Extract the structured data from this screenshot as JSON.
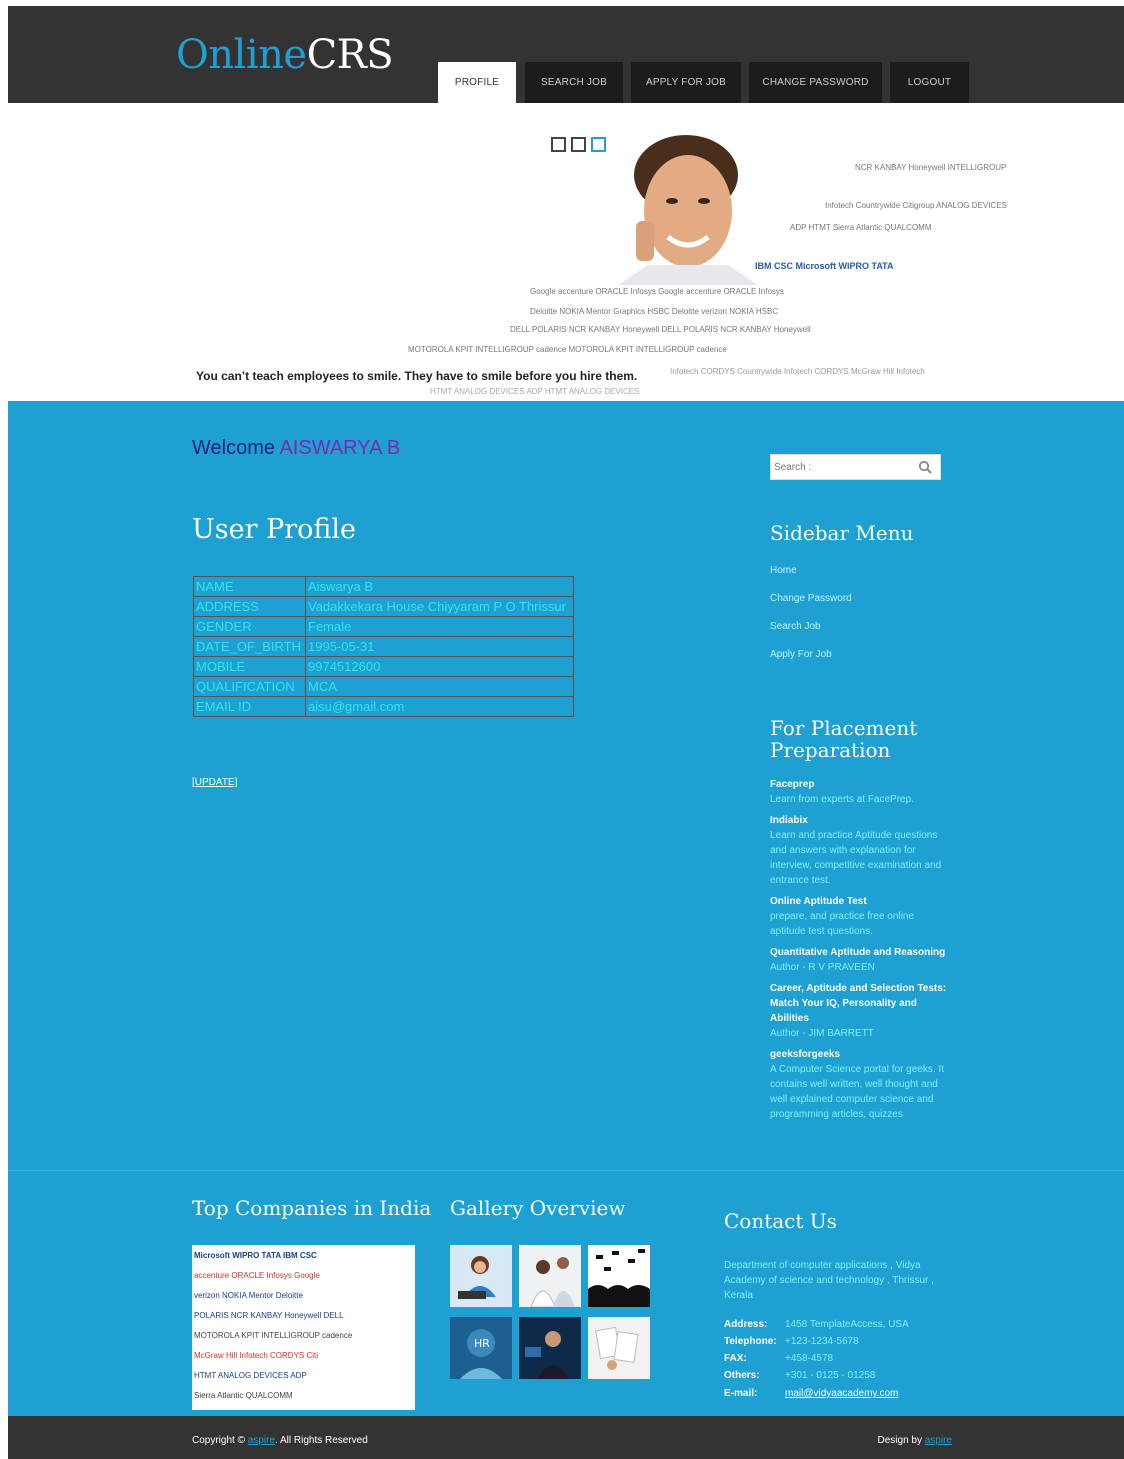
{
  "header": {
    "logo_part1": "Online",
    "logo_part2": "CRS",
    "tabs": [
      "PROFILE",
      "SEARCH JOB",
      "APPLY FOR JOB",
      "CHANGE PASSWORD",
      "LOGOUT"
    ],
    "active_tab": "PROFILE"
  },
  "banner": {
    "tagline": "You can’t teach employees to smile. They have to smile before you hire them.",
    "logo_rows": [
      "NCR  KANBAY  Honeywell  INTELLIGROUP",
      "Infotech  Countrywide  Citigroup  ANALOG DEVICES",
      "ADP  HTMT  Sierra Atlantic  QUALCOMM",
      "IBM  CSC  Microsoft  WIPRO  TATA",
      "Google  accenture  ORACLE  Infosys  Google  accenture  ORACLE  Infosys",
      "Deloitte  NOKIA  Mentor Graphics  HSBC  Deloitte  verizon  NOKIA  HSBC",
      "DELL  POLARIS  NCR  KANBAY  Honeywell  DELL  POLARIS  NCR  KANBAY  Honeywell",
      "MOTOROLA  KPIT  INTELLIGROUP  cadence  MOTOROLA  KPIT  INTELLIGROUP  cadence",
      "Infotech  CORDYS  Countrywide  Infotech  CORDYS  McGraw Hill  Infotech",
      "HTMT  ANALOG DEVICES  ADP  HTMT  ANALOG DEVICES"
    ]
  },
  "main": {
    "welcome_prefix": "Welcome",
    "user_name": "AISWARYA B",
    "profile_title": "User Profile",
    "profile": [
      {
        "key": "NAME",
        "value": "Aiswarya B"
      },
      {
        "key": "ADDRESS",
        "value": "Vadakkekara House Chiyyaram P O Thrissur"
      },
      {
        "key": "GENDER",
        "value": "Female"
      },
      {
        "key": "DATE_OF_BIRTH",
        "value": "1995-05-31"
      },
      {
        "key": "MOBILE",
        "value": "9974512600"
      },
      {
        "key": "QUALIFICATION",
        "value": "MCA"
      },
      {
        "key": "EMAIL ID",
        "value": "aisu@gmail.com"
      }
    ],
    "update_link": "[UPDATE]"
  },
  "sidebar": {
    "search_placeholder": "Search :",
    "menu_title": "Sidebar Menu",
    "menu": [
      "Home",
      "Change Password",
      "Search Job",
      "Apply For Job"
    ],
    "placement_title_1": "For Placement",
    "placement_title_2": "Preparation",
    "resources": [
      {
        "title": "Faceprep",
        "desc": "Learn from experts at FacePrep."
      },
      {
        "title": "Indiabix",
        "desc": "Learn and practice Aptitude questions and answers with explanation for interview, competitive examination and entrance test."
      },
      {
        "title": "Online Aptitude Test",
        "desc": "prepare, and practice free online aptitude test questions."
      },
      {
        "title": "Quantitative Aptitude and Reasoning",
        "desc": "Author - R V PRAVEEN"
      },
      {
        "title": "Career, Aptitude and Selection Tests: Match Your IQ, Personality and Abilities",
        "desc": "Author - JIM BARRETT"
      },
      {
        "title": "geeksforgeeks",
        "desc": "A Computer Science portal for geeks. It contains well written, well thought and well explained computer science and programming articles, quizzes"
      }
    ]
  },
  "footer": {
    "companies_title": "Top Companies in India",
    "company_rows": [
      "Microsoft  WIPRO  TATA  IBM  CSC",
      "accenture  ORACLE  Infosys  Google",
      "verizon  NOKIA  Mentor  Deloitte",
      "POLARIS  NCR  KANBAY  Honeywell  DELL",
      "MOTOROLA  KPIT  INTELLIGROUP  cadence",
      "McGraw Hill  Infotech  CORDYS  Citi",
      "HTMT  ANALOG DEVICES  ADP",
      "Sierra Atlantic  QUALCOMM"
    ],
    "gallery_title": "Gallery Overview",
    "contact_title": "Contact Us",
    "contact_intro": "Department of computer applications , Vidya Academy of science and technology , Thrissur , Kerala",
    "contact": [
      {
        "label": "Address:",
        "value": "1458 TemplateAccess, USA"
      },
      {
        "label": "Telephone:",
        "value": "+123-1234-5678"
      },
      {
        "label": "FAX:",
        "value": "+458-4578"
      },
      {
        "label": "Others:",
        "value": "+301 - 0125 - 01258"
      },
      {
        "label": "E-mail:",
        "value": "mail@vidyaacademy.com"
      }
    ],
    "copyright_prefix": "Copyright ©",
    "copyright_link": "aspire",
    "copyright_suffix": ". All Rights Reserved",
    "design_prefix": "Design by",
    "design_link": "aspire"
  },
  "colors": {
    "accent": "#1ea0d2",
    "dark": "#333333",
    "profile_text": "#36e2ec"
  }
}
